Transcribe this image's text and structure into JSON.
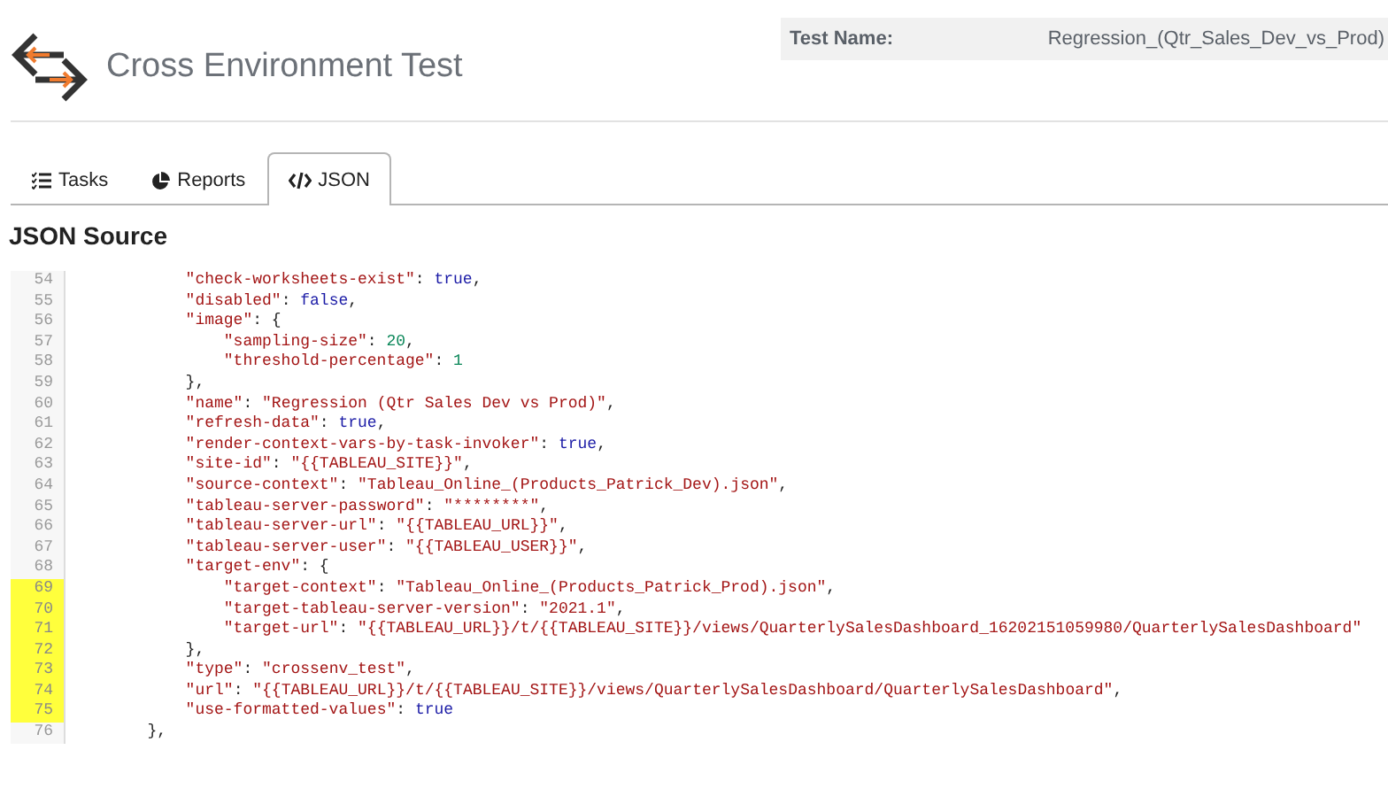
{
  "header": {
    "title": "Cross Environment Test",
    "test_name_label": "Test Name:",
    "test_name_value": "Regression_(Qtr_Sales_Dev_vs_Prod)"
  },
  "tabs": [
    {
      "label": "Tasks",
      "selected": false
    },
    {
      "label": "Reports",
      "selected": false
    },
    {
      "label": "JSON",
      "selected": true
    }
  ],
  "section_title": "JSON Source",
  "code_lines": [
    {
      "children": [
        {
          "number": "54",
          "highlighted": false,
          "tokens": [
            {
              "kind": "string",
              "text": "\"check-worksheets-exist\""
            },
            {
              "kind": "plain",
              "text": ": "
            },
            {
              "kind": "keyword",
              "text": "true"
            },
            {
              "kind": "plain",
              "text": ","
            }
          ]
        },
        {
          "number": "55",
          "highlighted": false,
          "tokens": [
            {
              "kind": "string",
              "text": "\"disabled\""
            },
            {
              "kind": "plain",
              "text": ": "
            },
            {
              "kind": "keyword",
              "text": "false"
            },
            {
              "kind": "plain",
              "text": ","
            }
          ]
        },
        {
          "number": "56",
          "highlighted": false,
          "tokens": [
            {
              "kind": "string",
              "text": "\"image\""
            },
            {
              "kind": "plain",
              "text": ": {"
            }
          ],
          "children": [
            {
              "number": "57",
              "highlighted": false,
              "tokens": [
                {
                  "kind": "string",
                  "text": "\"sampling-size\""
                },
                {
                  "kind": "plain",
                  "text": ": "
                },
                {
                  "kind": "number",
                  "text": "20"
                },
                {
                  "kind": "plain",
                  "text": ","
                }
              ]
            },
            {
              "number": "58",
              "highlighted": false,
              "tokens": [
                {
                  "kind": "string",
                  "text": "\"threshold-percentage\""
                },
                {
                  "kind": "plain",
                  "text": ": "
                },
                {
                  "kind": "number",
                  "text": "1"
                }
              ]
            }
          ]
        },
        {
          "number": "59",
          "highlighted": false,
          "tokens": [
            {
              "kind": "plain",
              "text": "},"
            }
          ]
        },
        {
          "number": "60",
          "highlighted": false,
          "tokens": [
            {
              "kind": "string",
              "text": "\"name\""
            },
            {
              "kind": "plain",
              "text": ": "
            },
            {
              "kind": "string",
              "text": "\"Regression (Qtr Sales Dev vs Prod)\""
            },
            {
              "kind": "plain",
              "text": ","
            }
          ]
        },
        {
          "number": "61",
          "highlighted": false,
          "tokens": [
            {
              "kind": "string",
              "text": "\"refresh-data\""
            },
            {
              "kind": "plain",
              "text": ": "
            },
            {
              "kind": "keyword",
              "text": "true"
            },
            {
              "kind": "plain",
              "text": ","
            }
          ]
        },
        {
          "number": "62",
          "highlighted": false,
          "tokens": [
            {
              "kind": "string",
              "text": "\"render-context-vars-by-task-invoker\""
            },
            {
              "kind": "plain",
              "text": ": "
            },
            {
              "kind": "keyword",
              "text": "true"
            },
            {
              "kind": "plain",
              "text": ","
            }
          ]
        },
        {
          "number": "63",
          "highlighted": false,
          "tokens": [
            {
              "kind": "string",
              "text": "\"site-id\""
            },
            {
              "kind": "plain",
              "text": ": "
            },
            {
              "kind": "string",
              "text": "\"{{TABLEAU_SITE}}\""
            },
            {
              "kind": "plain",
              "text": ","
            }
          ]
        },
        {
          "number": "64",
          "highlighted": false,
          "tokens": [
            {
              "kind": "string",
              "text": "\"source-context\""
            },
            {
              "kind": "plain",
              "text": ": "
            },
            {
              "kind": "string",
              "text": "\"Tableau_Online_(Products_Patrick_Dev).json\""
            },
            {
              "kind": "plain",
              "text": ","
            }
          ]
        },
        {
          "number": "65",
          "highlighted": false,
          "tokens": [
            {
              "kind": "string",
              "text": "\"tableau-server-password\""
            },
            {
              "kind": "plain",
              "text": ": "
            },
            {
              "kind": "string",
              "text": "\"********\""
            },
            {
              "kind": "plain",
              "text": ","
            }
          ]
        },
        {
          "number": "66",
          "highlighted": false,
          "tokens": [
            {
              "kind": "string",
              "text": "\"tableau-server-url\""
            },
            {
              "kind": "plain",
              "text": ": "
            },
            {
              "kind": "string",
              "text": "\"{{TABLEAU_URL}}\""
            },
            {
              "kind": "plain",
              "text": ","
            }
          ]
        },
        {
          "number": "67",
          "highlighted": false,
          "tokens": [
            {
              "kind": "string",
              "text": "\"tableau-server-user\""
            },
            {
              "kind": "plain",
              "text": ": "
            },
            {
              "kind": "string",
              "text": "\"{{TABLEAU_USER}}\""
            },
            {
              "kind": "plain",
              "text": ","
            }
          ]
        },
        {
          "number": "68",
          "highlighted": false,
          "tokens": [
            {
              "kind": "string",
              "text": "\"target-env\""
            },
            {
              "kind": "plain",
              "text": ": {"
            }
          ],
          "children": [
            {
              "number": "69",
              "highlighted": true,
              "tokens": [
                {
                  "kind": "string",
                  "text": "\"target-context\""
                },
                {
                  "kind": "plain",
                  "text": ": "
                },
                {
                  "kind": "string",
                  "text": "\"Tableau_Online_(Products_Patrick_Prod).json\""
                },
                {
                  "kind": "plain",
                  "text": ","
                }
              ]
            },
            {
              "number": "70",
              "highlighted": true,
              "tokens": [
                {
                  "kind": "string",
                  "text": "\"target-tableau-server-version\""
                },
                {
                  "kind": "plain",
                  "text": ": "
                },
                {
                  "kind": "string",
                  "text": "\"2021.1\""
                },
                {
                  "kind": "plain",
                  "text": ","
                }
              ]
            },
            {
              "number": "71",
              "highlighted": true,
              "tokens": [
                {
                  "kind": "string",
                  "text": "\"target-url\""
                },
                {
                  "kind": "plain",
                  "text": ": "
                },
                {
                  "kind": "string",
                  "text": "\"{{TABLEAU_URL}}/t/{{TABLEAU_SITE}}/views/QuarterlySalesDashboard_16202151059980/QuarterlySalesDashboard\""
                }
              ]
            }
          ]
        },
        {
          "number": "72",
          "highlighted": true,
          "tokens": [
            {
              "kind": "plain",
              "text": "},"
            }
          ]
        },
        {
          "number": "73",
          "highlighted": true,
          "tokens": [
            {
              "kind": "string",
              "text": "\"type\""
            },
            {
              "kind": "plain",
              "text": ": "
            },
            {
              "kind": "string",
              "text": "\"crossenv_test\""
            },
            {
              "kind": "plain",
              "text": ","
            }
          ]
        },
        {
          "number": "74",
          "highlighted": true,
          "tokens": [
            {
              "kind": "string",
              "text": "\"url\""
            },
            {
              "kind": "plain",
              "text": ": "
            },
            {
              "kind": "string",
              "text": "\"{{TABLEAU_URL}}/t/{{TABLEAU_SITE}}/views/QuarterlySalesDashboard/QuarterlySalesDashboard\""
            },
            {
              "kind": "plain",
              "text": ","
            }
          ]
        },
        {
          "number": "75",
          "highlighted": true,
          "tokens": [
            {
              "kind": "string",
              "text": "\"use-formatted-values\""
            },
            {
              "kind": "plain",
              "text": ": "
            },
            {
              "kind": "keyword",
              "text": "true"
            }
          ]
        }
      ]
    },
    {
      "number": "76",
      "highlighted": false,
      "tokens": [
        {
          "kind": "plain",
          "text": "},"
        }
      ]
    }
  ]
}
